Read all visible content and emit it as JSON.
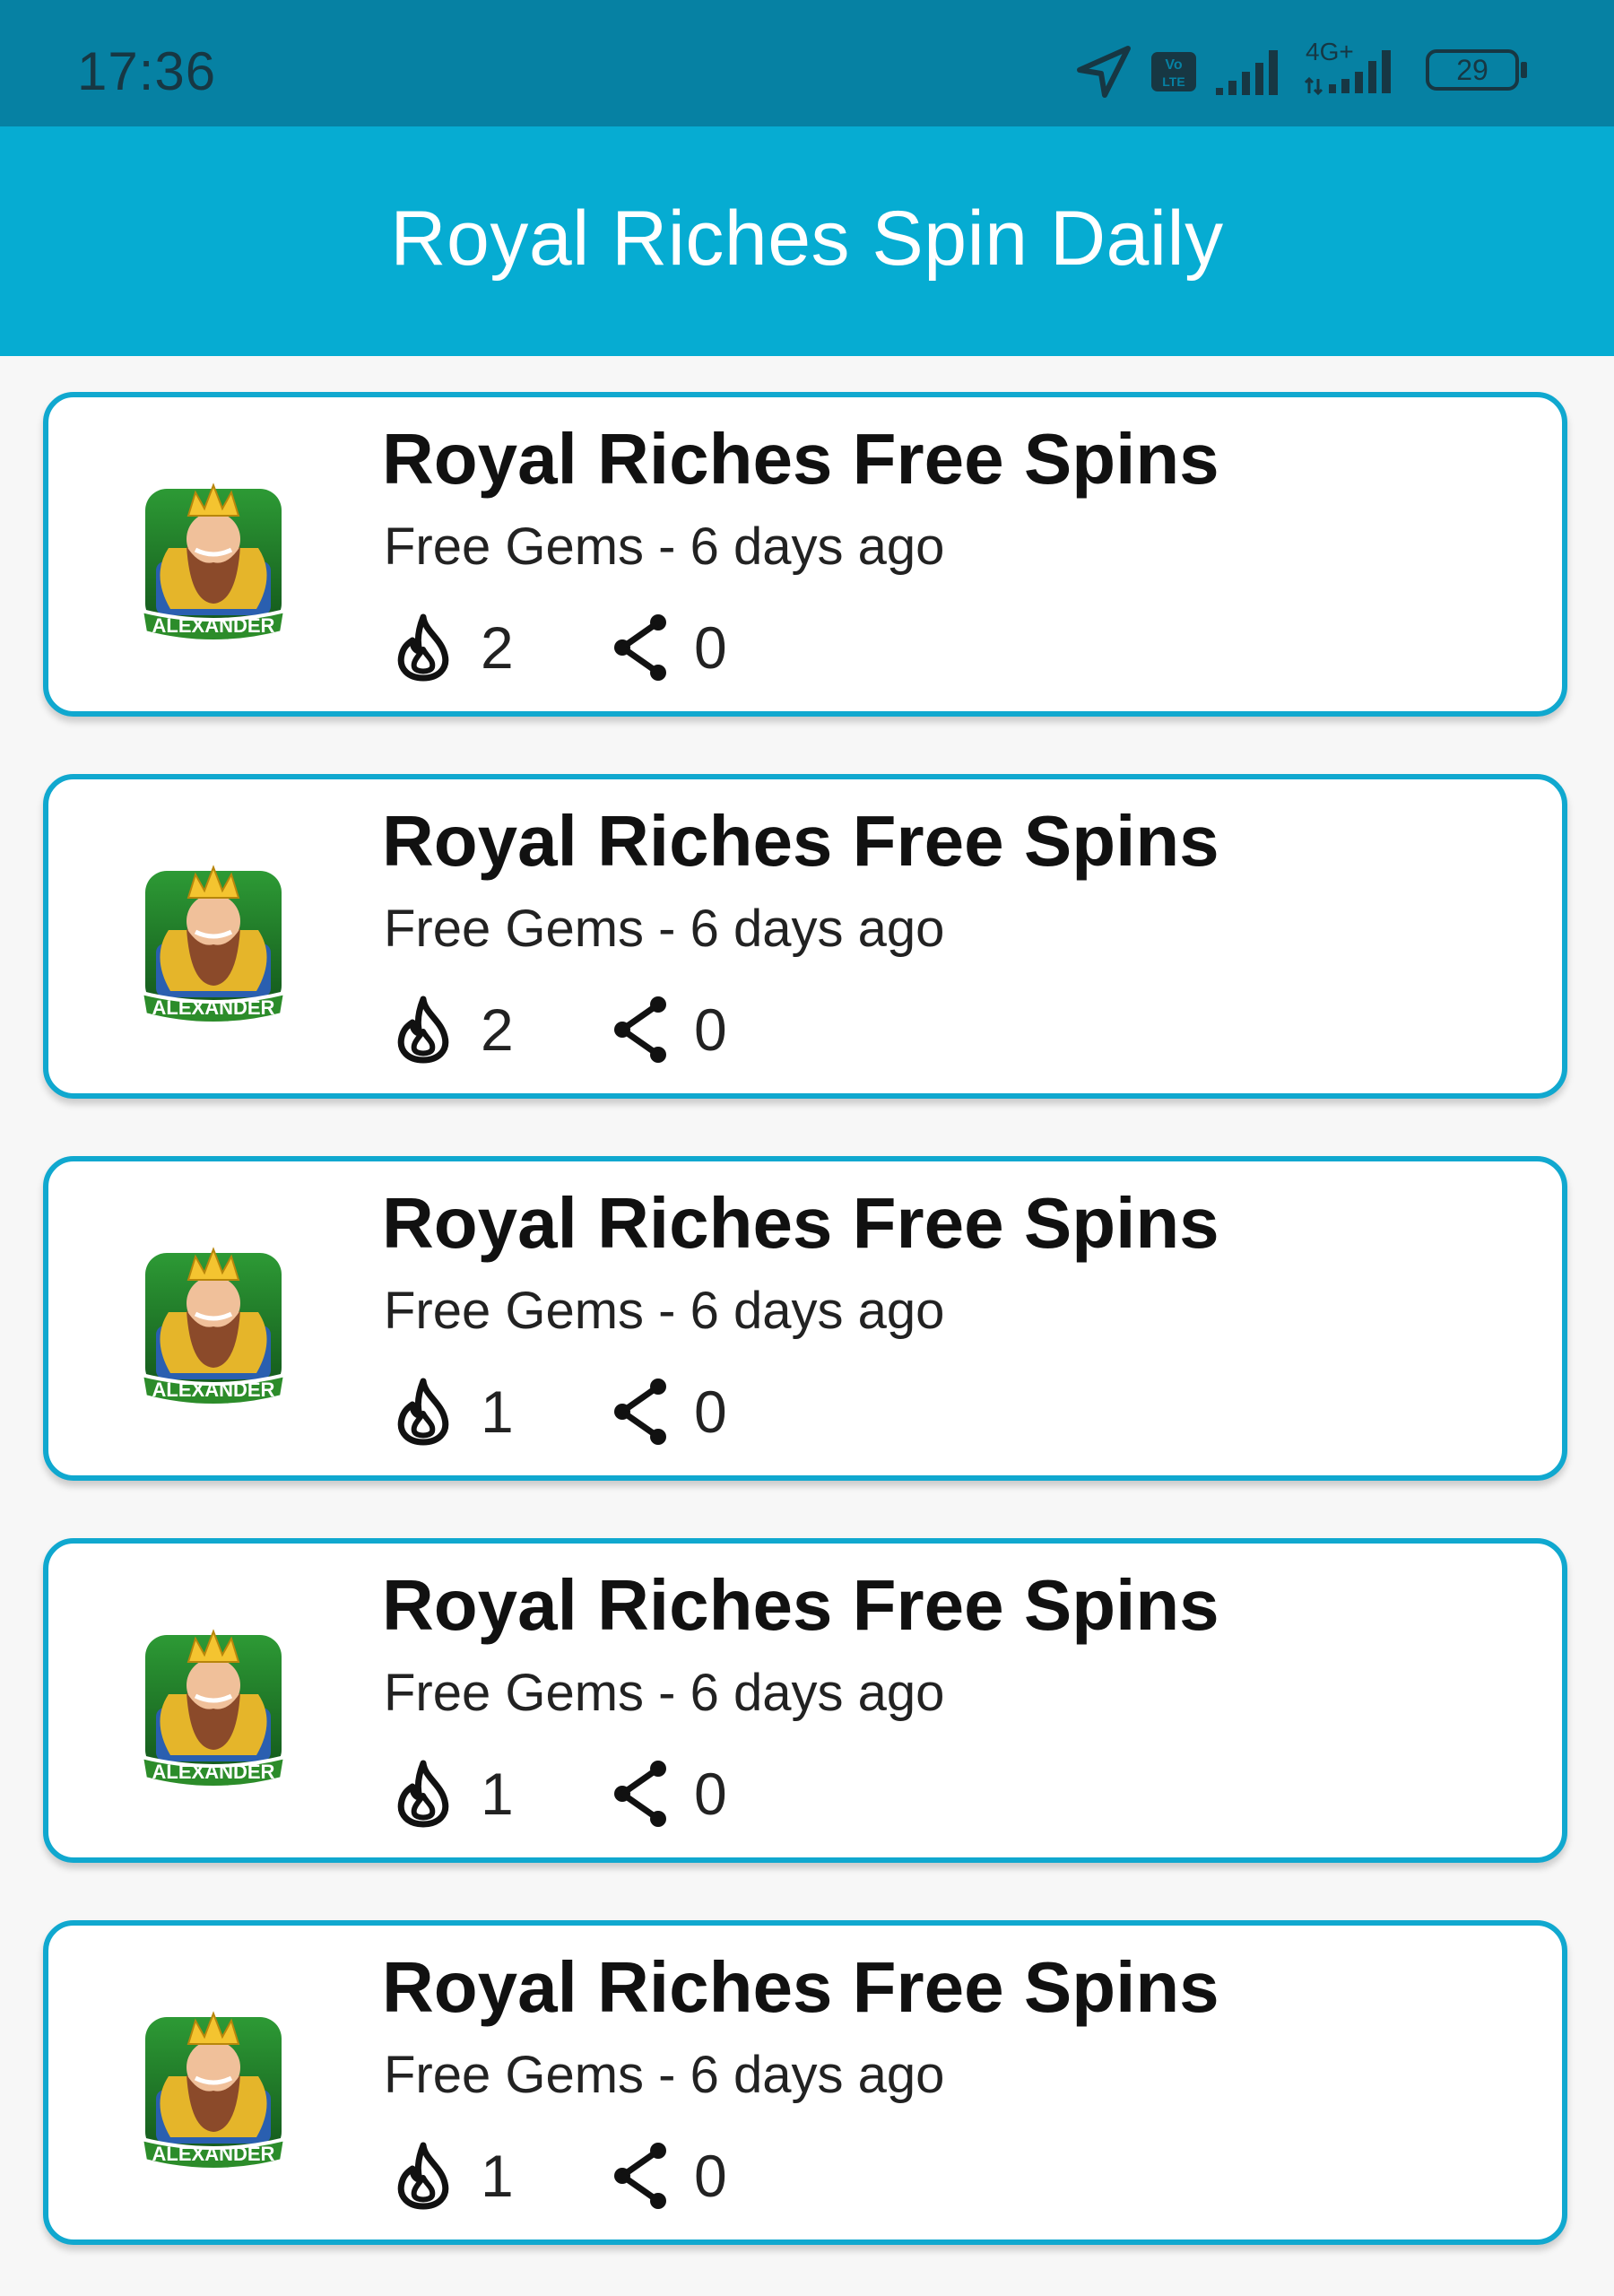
{
  "status_bar": {
    "time": "17:36",
    "network_label": "4G+",
    "volte_label": "Vo LTE",
    "battery_level": "29",
    "icons": [
      "location-arrow-icon",
      "volte-icon",
      "signal-icon",
      "signal-4g-icon",
      "battery-icon"
    ]
  },
  "app_bar": {
    "title": "Royal Riches Spin Daily"
  },
  "colors": {
    "status_bar": "#0681a3",
    "app_bar": "#06acd2",
    "card_border": "#10a8cf",
    "background": "#f7f7f7"
  },
  "avatar_label": "ALEXANDER",
  "cards": [
    {
      "title": "Royal Riches Free Spins",
      "subtitle": "Free Gems - 6 days ago",
      "fire_count": "2",
      "share_count": "0"
    },
    {
      "title": "Royal Riches Free Spins",
      "subtitle": "Free Gems - 6 days ago",
      "fire_count": "2",
      "share_count": "0"
    },
    {
      "title": "Royal Riches Free Spins",
      "subtitle": "Free Gems - 6 days ago",
      "fire_count": "1",
      "share_count": "0"
    },
    {
      "title": "Royal Riches Free Spins",
      "subtitle": "Free Gems - 6 days ago",
      "fire_count": "1",
      "share_count": "0"
    },
    {
      "title": "Royal Riches Free Spins",
      "subtitle": "Free Gems - 6 days ago",
      "fire_count": "1",
      "share_count": "0"
    }
  ]
}
